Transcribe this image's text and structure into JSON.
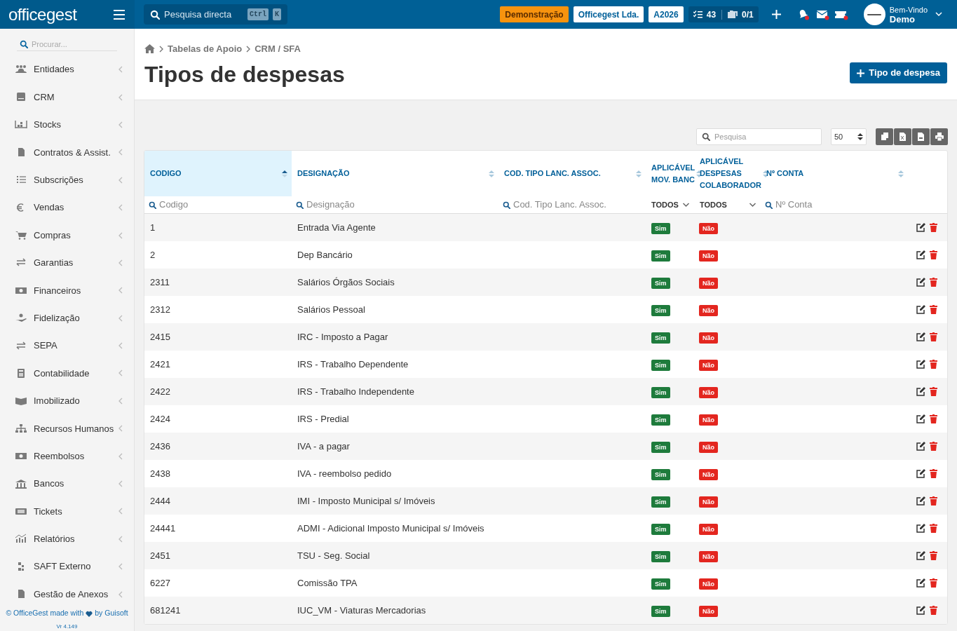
{
  "topbar": {
    "logo": "officegest",
    "search": {
      "placeholder": "Pesquisa directa",
      "keys": [
        "Ctrl",
        "K"
      ]
    },
    "badges": [
      {
        "label": "Demonstração",
        "kind": "warning"
      },
      {
        "label": "Officegest Lda.",
        "kind": "light"
      },
      {
        "label": "A2026",
        "kind": "light"
      }
    ],
    "counters": {
      "tasks": "43",
      "folders": "0/1"
    },
    "user": {
      "greeting": "Bem-Vindo",
      "name": "Demo"
    }
  },
  "sidebar": {
    "search": {
      "placeholder": "Procurar..."
    },
    "items": [
      {
        "label": "Entidades"
      },
      {
        "label": "CRM"
      },
      {
        "label": "Stocks"
      },
      {
        "label": "Contratos & Assist."
      },
      {
        "label": "Subscrições"
      },
      {
        "label": "Vendas"
      },
      {
        "label": "Compras"
      },
      {
        "label": "Garantias"
      },
      {
        "label": "Financeiros"
      },
      {
        "label": "Fidelização"
      },
      {
        "label": "SEPA"
      },
      {
        "label": "Contabilidade"
      },
      {
        "label": "Imobilizado"
      },
      {
        "label": "Recursos Humanos"
      },
      {
        "label": "Reembolsos"
      },
      {
        "label": "Bancos"
      },
      {
        "label": "Tickets"
      },
      {
        "label": "Relatórios"
      },
      {
        "label": "SAFT Externo"
      },
      {
        "label": "Gestão de Anexos"
      }
    ],
    "footer": {
      "before": "© OfficeGest made with",
      "after": "by Guisoft",
      "version": "Vr 4.149"
    }
  },
  "header": {
    "breadcrumb": [
      "Tabelas de Apoio",
      "CRM / SFA"
    ],
    "title": "Tipos de despesas",
    "add_button": "Tipo de despesa"
  },
  "toolbar": {
    "search": {
      "placeholder": "Pesquisa"
    },
    "page_size": "50"
  },
  "table": {
    "columns": [
      {
        "label": "CODIGO",
        "selected": true,
        "filter": {
          "kind": "search",
          "placeholder": "Codigo"
        }
      },
      {
        "label": "DESIGNAÇÃO",
        "selected": false,
        "filter": {
          "kind": "search",
          "placeholder": "Designação"
        }
      },
      {
        "label": "COD. TIPO LANC. ASSOC.",
        "selected": false,
        "filter": {
          "kind": "search",
          "placeholder": "Cod. Tipo Lanc. Assoc."
        }
      },
      {
        "label": "APLICÁVEL MOV. BANC",
        "selected": false,
        "filter": {
          "kind": "select",
          "value": "TODOS"
        }
      },
      {
        "label": "APLICÁVEL DESPESAS COLABORADOR",
        "selected": false,
        "filter": {
          "kind": "select",
          "value": "TODOS"
        }
      },
      {
        "label": "Nº CONTA",
        "selected": false,
        "filter": {
          "kind": "search",
          "placeholder": "Nº Conta"
        }
      }
    ],
    "rows": [
      {
        "codigo": "1",
        "designacao": "Entrada Via Agente",
        "mov_banc": {
          "label": "Sim",
          "on": true
        },
        "despesas_colaborador": {
          "label": "Não",
          "on": false
        }
      },
      {
        "codigo": "2",
        "designacao": "Dep Bancário",
        "mov_banc": {
          "label": "Sim",
          "on": true
        },
        "despesas_colaborador": {
          "label": "Não",
          "on": false
        }
      },
      {
        "codigo": "2311",
        "designacao": "Salários Órgãos Sociais",
        "mov_banc": {
          "label": "Sim",
          "on": true
        },
        "despesas_colaborador": {
          "label": "Não",
          "on": false
        }
      },
      {
        "codigo": "2312",
        "designacao": "Salários Pessoal",
        "mov_banc": {
          "label": "Sim",
          "on": true
        },
        "despesas_colaborador": {
          "label": "Não",
          "on": false
        }
      },
      {
        "codigo": "2415",
        "designacao": "IRC - Imposto a Pagar",
        "mov_banc": {
          "label": "Sim",
          "on": true
        },
        "despesas_colaborador": {
          "label": "Não",
          "on": false
        }
      },
      {
        "codigo": "2421",
        "designacao": "IRS - Trabalho Dependente",
        "mov_banc": {
          "label": "Sim",
          "on": true
        },
        "despesas_colaborador": {
          "label": "Não",
          "on": false
        }
      },
      {
        "codigo": "2422",
        "designacao": "IRS - Trabalho Independente",
        "mov_banc": {
          "label": "Sim",
          "on": true
        },
        "despesas_colaborador": {
          "label": "Não",
          "on": false
        }
      },
      {
        "codigo": "2424",
        "designacao": "IRS - Predial",
        "mov_banc": {
          "label": "Sim",
          "on": true
        },
        "despesas_colaborador": {
          "label": "Não",
          "on": false
        }
      },
      {
        "codigo": "2436",
        "designacao": "IVA - a pagar",
        "mov_banc": {
          "label": "Sim",
          "on": true
        },
        "despesas_colaborador": {
          "label": "Não",
          "on": false
        }
      },
      {
        "codigo": "2438",
        "designacao": "IVA - reembolso pedido",
        "mov_banc": {
          "label": "Sim",
          "on": true
        },
        "despesas_colaborador": {
          "label": "Não",
          "on": false
        }
      },
      {
        "codigo": "2444",
        "designacao": "IMI - Imposto Municipal s/ Imóveis",
        "mov_banc": {
          "label": "Sim",
          "on": true
        },
        "despesas_colaborador": {
          "label": "Não",
          "on": false
        }
      },
      {
        "codigo": "24441",
        "designacao": "ADMI - Adicional Imposto Municipal s/ Imóveis",
        "mov_banc": {
          "label": "Sim",
          "on": true
        },
        "despesas_colaborador": {
          "label": "Não",
          "on": false
        }
      },
      {
        "codigo": "2451",
        "designacao": "TSU - Seg. Social",
        "mov_banc": {
          "label": "Sim",
          "on": true
        },
        "despesas_colaborador": {
          "label": "Não",
          "on": false
        }
      },
      {
        "codigo": "6227",
        "designacao": "Comissão TPA",
        "mov_banc": {
          "label": "Sim",
          "on": true
        },
        "despesas_colaborador": {
          "label": "Não",
          "on": false
        }
      },
      {
        "codigo": "681241",
        "designacao": "IUC_VM - Viaturas Mercadorias",
        "mov_banc": {
          "label": "Sim",
          "on": true
        },
        "despesas_colaborador": {
          "label": "Não",
          "on": false
        }
      }
    ]
  }
}
